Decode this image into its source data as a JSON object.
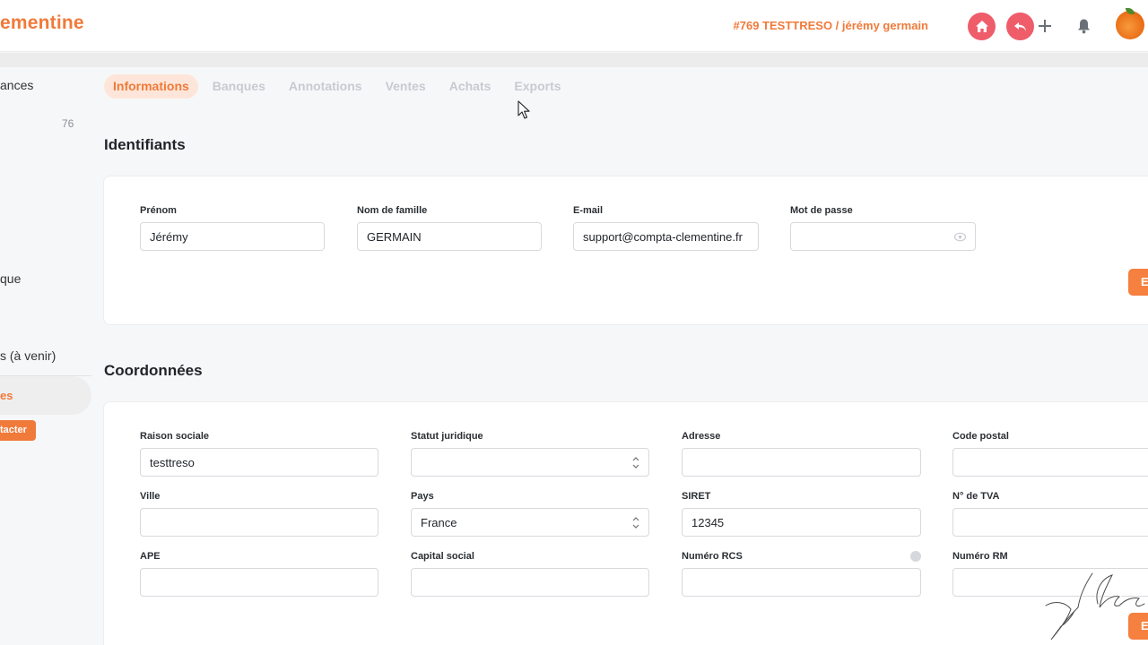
{
  "header": {
    "logo": "ementine",
    "dossier": "#769 TESTTRESO / jérémy germain",
    "icons": [
      "home-icon",
      "undo-icon",
      "plus-icon",
      "bell-icon",
      "avatar-orange"
    ],
    "accent_color": "#f07a3a",
    "danger_color": "#ef5c6a"
  },
  "sidebar": {
    "items": [
      {
        "label": "ances"
      },
      {
        "count": "76"
      },
      {
        "label": "que"
      },
      {
        "label": "s (à venir)"
      },
      {
        "label": "es"
      }
    ],
    "contact_button": "tacter"
  },
  "tabs": [
    {
      "label": "Informations",
      "active": true
    },
    {
      "label": "Banques",
      "active": false
    },
    {
      "label": "Annotations",
      "active": false
    },
    {
      "label": "Ventes",
      "active": false
    },
    {
      "label": "Achats",
      "active": false
    },
    {
      "label": "Exports",
      "active": false
    }
  ],
  "identifiants": {
    "title": "Identifiants",
    "fields": {
      "prenom": {
        "label": "Prénom",
        "value": "Jérémy"
      },
      "nom": {
        "label": "Nom de famille",
        "value": "GERMAIN"
      },
      "email": {
        "label": "E-mail",
        "value": "support@compta-clementine.fr"
      },
      "password": {
        "label": "Mot de passe",
        "value": ""
      }
    },
    "save_label": "E"
  },
  "coordonnees": {
    "title": "Coordonnées",
    "fields": {
      "raison_sociale": {
        "label": "Raison sociale",
        "value": "testtreso"
      },
      "statut_juridique": {
        "label": "Statut juridique",
        "value": ""
      },
      "adresse": {
        "label": "Adresse",
        "value": ""
      },
      "code_postal": {
        "label": "Code postal",
        "value": ""
      },
      "ville": {
        "label": "Ville",
        "value": ""
      },
      "pays": {
        "label": "Pays",
        "value": "France"
      },
      "siret": {
        "label": "SIRET",
        "value": "12345"
      },
      "tva": {
        "label": "N° de TVA",
        "value": ""
      },
      "ape": {
        "label": "APE",
        "value": ""
      },
      "capital": {
        "label": "Capital social",
        "value": ""
      },
      "rcs": {
        "label": "Numéro RCS",
        "value": ""
      },
      "rm": {
        "label": "Numéro RM",
        "value": ""
      }
    },
    "save_label": "E"
  }
}
